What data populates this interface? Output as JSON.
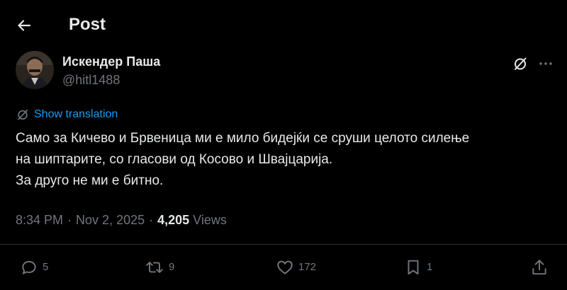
{
  "header": {
    "title": "Post"
  },
  "tweet": {
    "author": {
      "name": "Искендер Паша",
      "handle": "@hitl1488"
    },
    "translate_label": "Show translation",
    "lines": [
      "Само за Кичево и Брвеница ми е мило бидејќи се сруши целото силење",
      "на шиптарите, со гласови од Косово и Швајцарија.",
      "За друго не ми е битно."
    ],
    "time": "8:34 PM",
    "date": "Nov 2, 2025",
    "views_count": "4,205",
    "views_label": "Views"
  },
  "actions": {
    "replies": "5",
    "reposts": "9",
    "likes": "172",
    "bookmarks": "1"
  },
  "icons": {
    "back": "arrow-left-icon",
    "grok": "grok-icon",
    "more": "more-horizontal-icon",
    "translate": "translate-icon",
    "reply": "reply-icon",
    "repost": "repost-icon",
    "like": "heart-icon",
    "bookmark": "bookmark-icon",
    "share": "share-icon"
  },
  "colors": {
    "background": "#000000",
    "text": "#e7e9ea",
    "secondary": "#71767b",
    "accent": "#1d9bf0",
    "divider": "#2f3336"
  }
}
